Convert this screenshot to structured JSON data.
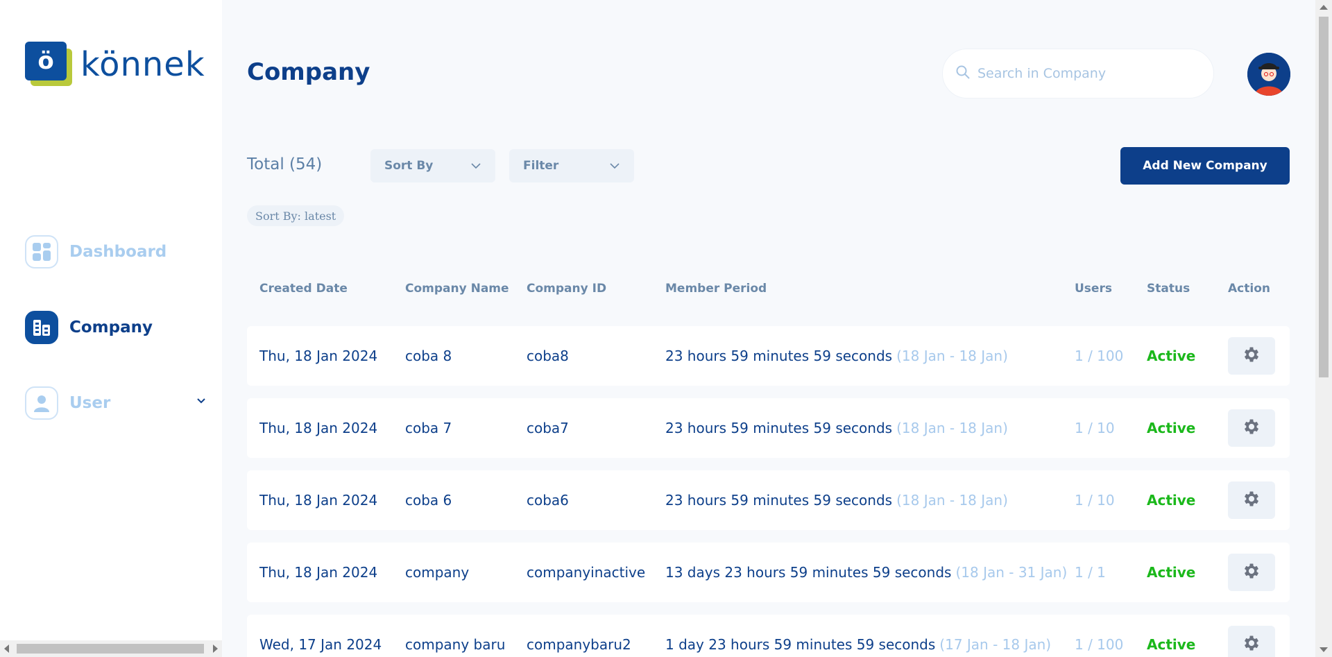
{
  "brand": {
    "mark_letter": "ö",
    "name": "könnek"
  },
  "sidebar": {
    "items": [
      {
        "label": "Dashboard",
        "icon": "dashboard-icon"
      },
      {
        "label": "Company",
        "icon": "company-icon"
      },
      {
        "label": "User",
        "icon": "user-icon"
      }
    ]
  },
  "header": {
    "title": "Company",
    "search_placeholder": "Search in Company"
  },
  "toolbar": {
    "total": "Total (54)",
    "sort_label": "Sort By",
    "filter_label": "Filter",
    "add_label": "Add New Company",
    "sort_chip": "Sort By: latest"
  },
  "table": {
    "headers": [
      "Created Date",
      "Company Name",
      "Company ID",
      "Member Period",
      "Users",
      "Status",
      "Action"
    ],
    "rows": [
      {
        "date": "Thu, 18 Jan 2024",
        "name": "coba 8",
        "id": "coba8",
        "period": "23 hours 59 minutes 59 seconds",
        "range": "(18 Jan - 18 Jan)",
        "users": "1 / 100",
        "status": "Active"
      },
      {
        "date": "Thu, 18 Jan 2024",
        "name": "coba 7",
        "id": "coba7",
        "period": "23 hours 59 minutes 59 seconds",
        "range": "(18 Jan - 18 Jan)",
        "users": "1 / 10",
        "status": "Active"
      },
      {
        "date": "Thu, 18 Jan 2024",
        "name": "coba 6",
        "id": "coba6",
        "period": "23 hours 59 minutes 59 seconds",
        "range": "(18 Jan - 18 Jan)",
        "users": "1 / 10",
        "status": "Active"
      },
      {
        "date": "Thu, 18 Jan 2024",
        "name": "company",
        "id": "companyinactive",
        "period": "13 days 23 hours 59 minutes 59 seconds",
        "range": "(18 Jan - 31 Jan)",
        "users": "1 / 1",
        "status": "Active"
      },
      {
        "date": "Wed, 17 Jan 2024",
        "name": "company baru",
        "id": "companybaru2",
        "period": "1 day 23 hours 59 minutes 59 seconds",
        "range": "(17 Jan - 18 Jan)",
        "users": "1 / 100",
        "status": "Active"
      }
    ]
  },
  "colors": {
    "primary": "#0d3f8a",
    "accent_green": "#b9c93b",
    "status_active": "#1bb81b",
    "muted": "#a7c9ec"
  }
}
